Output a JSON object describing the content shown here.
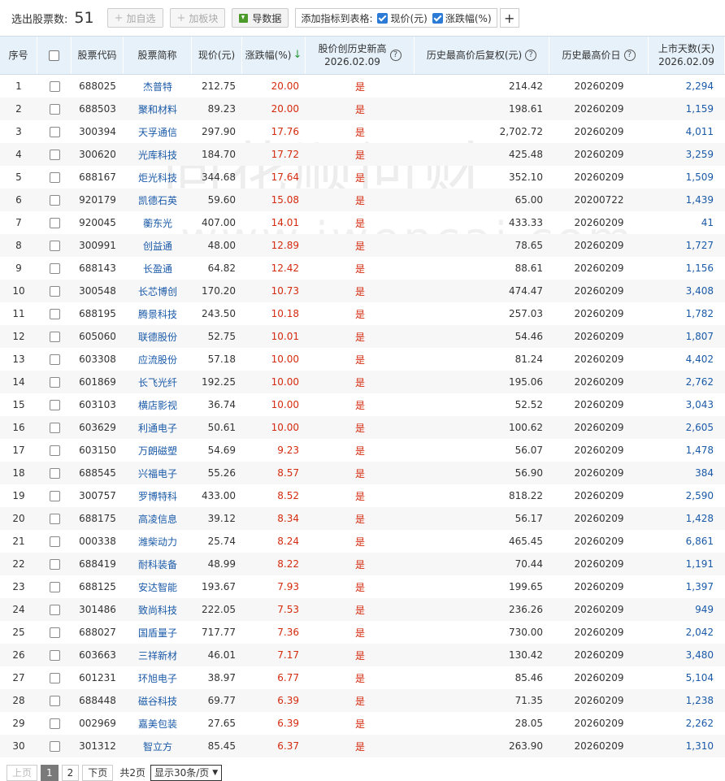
{
  "toolbar": {
    "label": "选出股票数:",
    "count": "51",
    "add_watch": "加自选",
    "add_block": "加板块",
    "export": "导数据",
    "indicator_label": "添加指标到表格:",
    "ind1": "现价(元)",
    "ind2": "涨跌幅(%)",
    "add_icon": "plus-icon"
  },
  "columns": {
    "seq": "序号",
    "code": "股票代码",
    "name": "股票简称",
    "price": "现价(元)",
    "change": "涨跌幅(%)",
    "new_high_l1": "股价创历史新高",
    "new_high_l2": "2026.02.09",
    "hist_high": "历史最高价后复权(元)",
    "hist_high_date": "历史最高价日",
    "days_l1": "上市天数(天)",
    "days_l2": "2026.02.09"
  },
  "watermark": {
    "line1": "同花顺问财",
    "line2": "www.iwencai.com"
  },
  "rows": [
    {
      "seq": "1",
      "code": "688025",
      "name": "杰普特",
      "price": "212.75",
      "chg": "20.00",
      "nh": "是",
      "hh": "214.42",
      "hd": "20260209",
      "days": "2,294"
    },
    {
      "seq": "2",
      "code": "688503",
      "name": "聚和材料",
      "price": "89.23",
      "chg": "20.00",
      "nh": "是",
      "hh": "198.61",
      "hd": "20260209",
      "days": "1,159"
    },
    {
      "seq": "3",
      "code": "300394",
      "name": "天孚通信",
      "price": "297.90",
      "chg": "17.76",
      "nh": "是",
      "hh": "2,702.72",
      "hd": "20260209",
      "days": "4,011"
    },
    {
      "seq": "4",
      "code": "300620",
      "name": "光库科技",
      "price": "184.70",
      "chg": "17.72",
      "nh": "是",
      "hh": "425.48",
      "hd": "20260209",
      "days": "3,259"
    },
    {
      "seq": "5",
      "code": "688167",
      "name": "炬光科技",
      "price": "344.68",
      "chg": "17.64",
      "nh": "是",
      "hh": "352.10",
      "hd": "20260209",
      "days": "1,509"
    },
    {
      "seq": "6",
      "code": "920179",
      "name": "凯德石英",
      "price": "59.60",
      "chg": "15.08",
      "nh": "是",
      "hh": "65.00",
      "hd": "20200722",
      "days": "1,439"
    },
    {
      "seq": "7",
      "code": "920045",
      "name": "蘅东光",
      "price": "407.00",
      "chg": "14.01",
      "nh": "是",
      "hh": "433.33",
      "hd": "20260209",
      "days": "41"
    },
    {
      "seq": "8",
      "code": "300991",
      "name": "创益通",
      "price": "48.00",
      "chg": "12.89",
      "nh": "是",
      "hh": "78.65",
      "hd": "20260209",
      "days": "1,727"
    },
    {
      "seq": "9",
      "code": "688143",
      "name": "长盈通",
      "price": "64.82",
      "chg": "12.42",
      "nh": "是",
      "hh": "88.61",
      "hd": "20260209",
      "days": "1,156"
    },
    {
      "seq": "10",
      "code": "300548",
      "name": "长芯博创",
      "price": "170.20",
      "chg": "10.73",
      "nh": "是",
      "hh": "474.47",
      "hd": "20260209",
      "days": "3,408"
    },
    {
      "seq": "11",
      "code": "688195",
      "name": "腾景科技",
      "price": "243.50",
      "chg": "10.18",
      "nh": "是",
      "hh": "257.03",
      "hd": "20260209",
      "days": "1,782"
    },
    {
      "seq": "12",
      "code": "605060",
      "name": "联德股份",
      "price": "52.75",
      "chg": "10.01",
      "nh": "是",
      "hh": "54.46",
      "hd": "20260209",
      "days": "1,807"
    },
    {
      "seq": "13",
      "code": "603308",
      "name": "应流股份",
      "price": "57.18",
      "chg": "10.00",
      "nh": "是",
      "hh": "81.24",
      "hd": "20260209",
      "days": "4,402"
    },
    {
      "seq": "14",
      "code": "601869",
      "name": "长飞光纤",
      "price": "192.25",
      "chg": "10.00",
      "nh": "是",
      "hh": "195.06",
      "hd": "20260209",
      "days": "2,762"
    },
    {
      "seq": "15",
      "code": "603103",
      "name": "横店影视",
      "price": "36.74",
      "chg": "10.00",
      "nh": "是",
      "hh": "52.52",
      "hd": "20260209",
      "days": "3,043"
    },
    {
      "seq": "16",
      "code": "603629",
      "name": "利通电子",
      "price": "50.61",
      "chg": "10.00",
      "nh": "是",
      "hh": "100.62",
      "hd": "20260209",
      "days": "2,605"
    },
    {
      "seq": "17",
      "code": "603150",
      "name": "万朗磁塑",
      "price": "54.69",
      "chg": "9.23",
      "nh": "是",
      "hh": "56.07",
      "hd": "20260209",
      "days": "1,478"
    },
    {
      "seq": "18",
      "code": "688545",
      "name": "兴福电子",
      "price": "55.26",
      "chg": "8.57",
      "nh": "是",
      "hh": "56.90",
      "hd": "20260209",
      "days": "384"
    },
    {
      "seq": "19",
      "code": "300757",
      "name": "罗博特科",
      "price": "433.00",
      "chg": "8.52",
      "nh": "是",
      "hh": "818.22",
      "hd": "20260209",
      "days": "2,590"
    },
    {
      "seq": "20",
      "code": "688175",
      "name": "高凌信息",
      "price": "39.12",
      "chg": "8.34",
      "nh": "是",
      "hh": "56.17",
      "hd": "20260209",
      "days": "1,428"
    },
    {
      "seq": "21",
      "code": "000338",
      "name": "潍柴动力",
      "price": "25.74",
      "chg": "8.24",
      "nh": "是",
      "hh": "465.45",
      "hd": "20260209",
      "days": "6,861"
    },
    {
      "seq": "22",
      "code": "688419",
      "name": "耐科装备",
      "price": "48.99",
      "chg": "8.22",
      "nh": "是",
      "hh": "70.44",
      "hd": "20260209",
      "days": "1,191"
    },
    {
      "seq": "23",
      "code": "688125",
      "name": "安达智能",
      "price": "193.67",
      "chg": "7.93",
      "nh": "是",
      "hh": "199.65",
      "hd": "20260209",
      "days": "1,397"
    },
    {
      "seq": "24",
      "code": "301486",
      "name": "致尚科技",
      "price": "222.05",
      "chg": "7.53",
      "nh": "是",
      "hh": "236.26",
      "hd": "20260209",
      "days": "949"
    },
    {
      "seq": "25",
      "code": "688027",
      "name": "国盾量子",
      "price": "717.77",
      "chg": "7.36",
      "nh": "是",
      "hh": "730.00",
      "hd": "20260209",
      "days": "2,042"
    },
    {
      "seq": "26",
      "code": "603663",
      "name": "三祥新材",
      "price": "46.01",
      "chg": "7.17",
      "nh": "是",
      "hh": "130.42",
      "hd": "20260209",
      "days": "3,480"
    },
    {
      "seq": "27",
      "code": "601231",
      "name": "环旭电子",
      "price": "38.97",
      "chg": "6.77",
      "nh": "是",
      "hh": "85.46",
      "hd": "20260209",
      "days": "5,104"
    },
    {
      "seq": "28",
      "code": "688448",
      "name": "磁谷科技",
      "price": "69.77",
      "chg": "6.39",
      "nh": "是",
      "hh": "71.35",
      "hd": "20260209",
      "days": "1,238"
    },
    {
      "seq": "29",
      "code": "002969",
      "name": "嘉美包装",
      "price": "27.65",
      "chg": "6.39",
      "nh": "是",
      "hh": "28.05",
      "hd": "20260209",
      "days": "2,262"
    },
    {
      "seq": "30",
      "code": "301312",
      "name": "智立方",
      "price": "85.45",
      "chg": "6.37",
      "nh": "是",
      "hh": "263.90",
      "hd": "20260209",
      "days": "1,310"
    }
  ],
  "pager": {
    "prev": "上页",
    "page1": "1",
    "page2": "2",
    "next": "下页",
    "total": "共2页",
    "per_page": "显示30条/页"
  }
}
